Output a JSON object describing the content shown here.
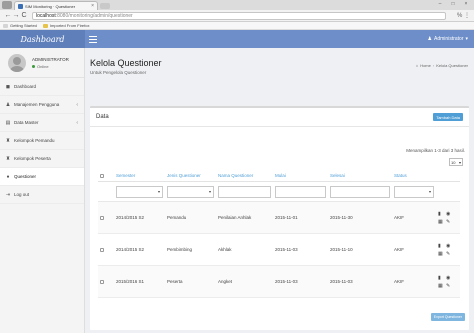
{
  "browser": {
    "tab_title": "SIM Monitoring · Questioner",
    "tab_close": "×",
    "address_host": "localhost",
    "address_path": ":8080/monitoring/admin/questioner",
    "nav_back": "←",
    "nav_forward": "→",
    "nav_reload": "C",
    "toolbar_right": "% ⋮",
    "window_controls": [
      "–",
      "□",
      "×"
    ],
    "bookmarks": [
      "Getting Started",
      "Imported From Firefox"
    ]
  },
  "header": {
    "brand": "Dashboard",
    "admin_label": "Administrator",
    "admin_icon": "user-icon",
    "admin_caret": "▾"
  },
  "sidebar": {
    "user_name": "ADMINISTRATOR",
    "user_status": "Online",
    "items": [
      {
        "label": "Dashboard",
        "icon": "dashboard-icon",
        "glyph": "◼",
        "chevron": ""
      },
      {
        "label": "Manajemen Pengguna",
        "icon": "users-icon",
        "glyph": "♟",
        "chevron": "‹"
      },
      {
        "label": "Data Master",
        "icon": "database-icon",
        "glyph": "▤",
        "chevron": "‹"
      },
      {
        "label": "Kelompok Pemandu",
        "icon": "group-icon",
        "glyph": "♜",
        "chevron": ""
      },
      {
        "label": "Kelompok Peserta",
        "icon": "group-icon",
        "glyph": "♜",
        "chevron": ""
      },
      {
        "label": "Questioner",
        "icon": "question-icon",
        "glyph": "●",
        "chevron": ""
      },
      {
        "label": "Log out",
        "icon": "logout-icon",
        "glyph": "⇥",
        "chevron": ""
      }
    ]
  },
  "page": {
    "title": "Kelola Questioner",
    "subtitle": "Untuk Pengelola Questioner",
    "breadcrumb_home": "Home",
    "breadcrumb_current": "Kelola Questioner"
  },
  "box": {
    "title": "Data",
    "add_button": "Tambah Data",
    "show_info": "Menampilkan 1-3 dari 3 hasil.",
    "page_size": "10",
    "export_button": "Export Questioner"
  },
  "table": {
    "columns": [
      "Semester",
      "Jenis Questioner",
      "Nama Questioner",
      "Mulai",
      "Selesai",
      "Status"
    ],
    "rows": [
      [
        "2014/2015 S2",
        "Pemandu",
        "Penilaian Anhlak",
        "2015-11-01",
        "2015-11-30",
        "AKIF"
      ],
      [
        "2014/2015 S2",
        "Pembimbing",
        "Akhlak",
        "2015-11-03",
        "2015-11-10",
        "AKIF"
      ],
      [
        "2015/2016 S1",
        "Peserta",
        "Angket",
        "2015-11-03",
        "2015-11-03",
        "AKIF"
      ]
    ]
  }
}
